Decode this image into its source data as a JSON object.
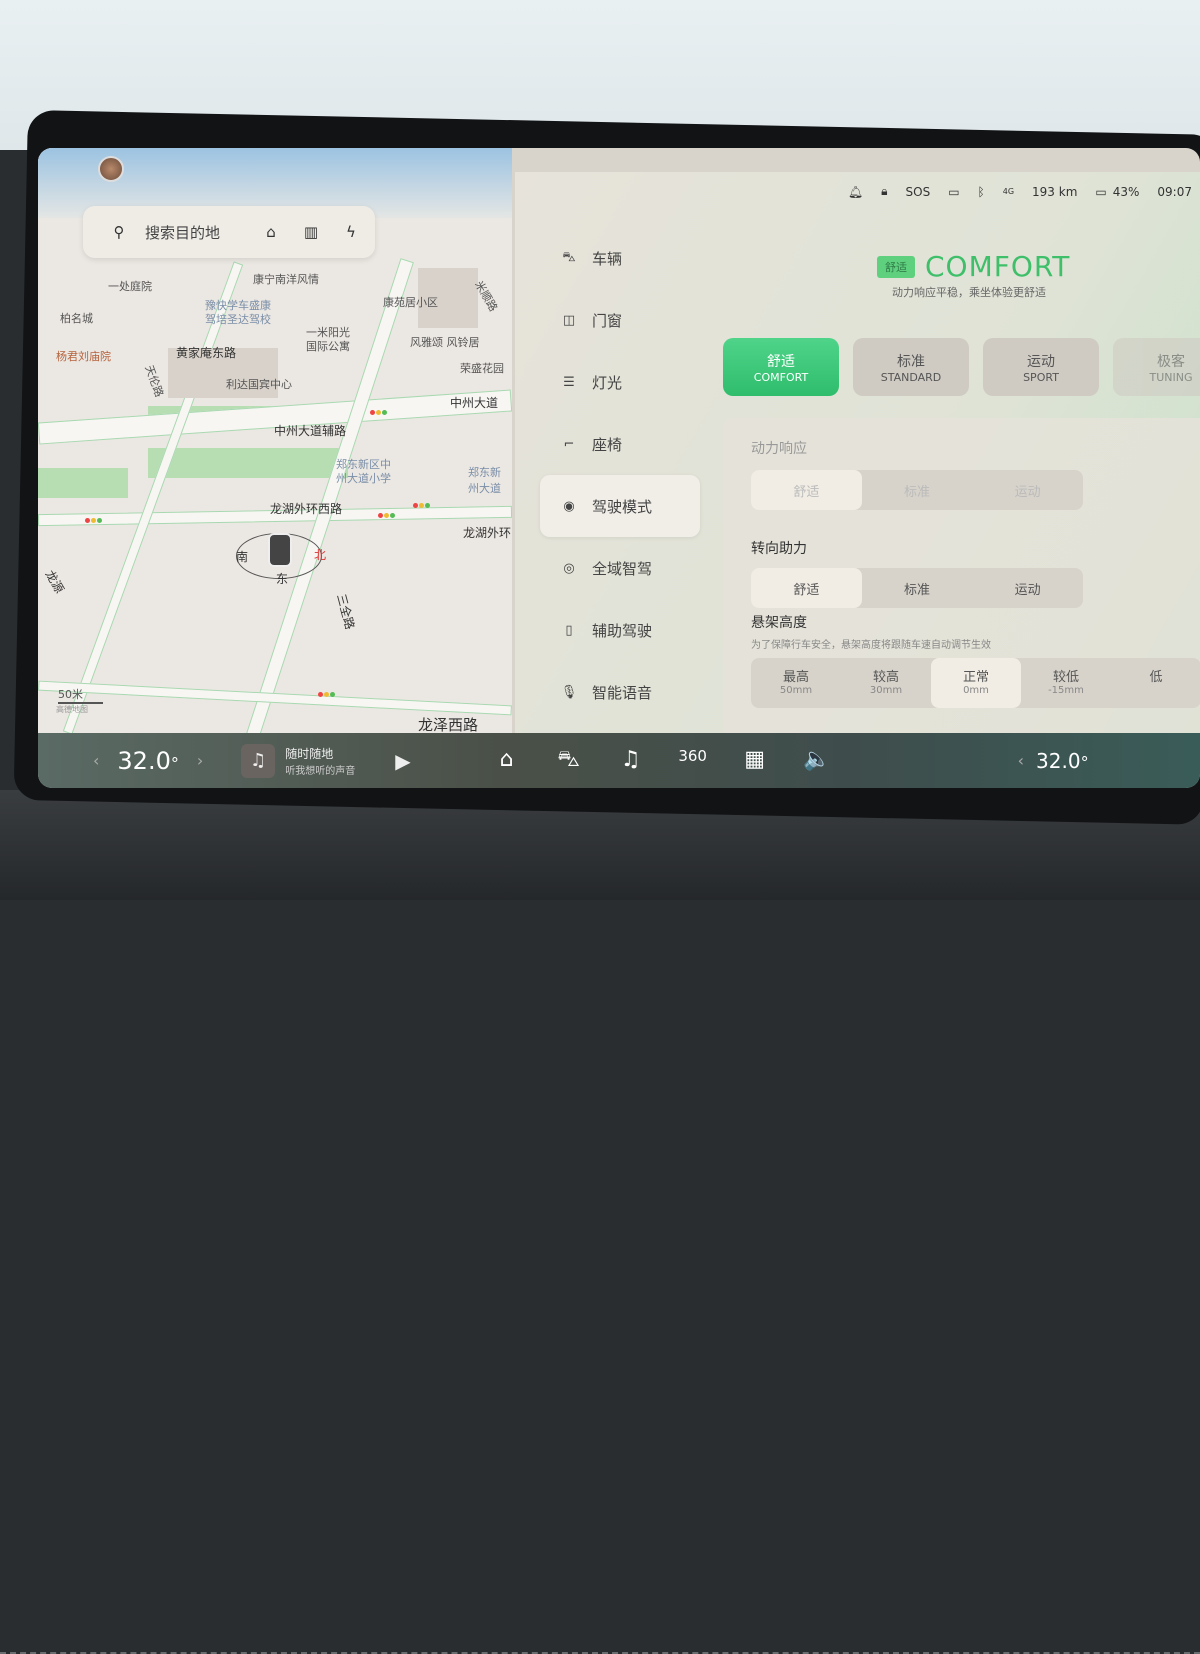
{
  "map": {
    "search_placeholder": "搜索目的地",
    "shortcuts": [
      {
        "icon": "home-icon",
        "glyph": "⌂"
      },
      {
        "icon": "company-icon",
        "glyph": "▥"
      },
      {
        "icon": "charging-icon",
        "glyph": "ϟ"
      }
    ],
    "labels": [
      "一处庭院",
      "康宁南洋风情",
      "豫快学车盛康",
      "驾培圣达驾校",
      "柏名城",
      "康苑居小区",
      "一米阳光",
      "国际公寓",
      "风雅颂 风铃居",
      "杨君刘庙院",
      "黄家庵东路",
      "荣盛花园",
      "利达国宾中心",
      "天伦路",
      "中州大道",
      "中州大道辅路",
      "郑东新区中",
      "州大道小学",
      "郑东新",
      "州大道",
      "龙湖外环西路",
      "龙湖外环",
      "龙源",
      "三全路",
      "龙泽西路",
      "米顺路"
    ],
    "compass": {
      "south": "南",
      "north": "北",
      "east": "东"
    },
    "scale": "50米",
    "attribution": "高德地图"
  },
  "status": {
    "items": [
      "bell-icon",
      "lock-icon"
    ],
    "sos": "SOS",
    "signal": "4G",
    "range": "193 km",
    "battery": "43%",
    "time": "09:07"
  },
  "nav": [
    {
      "label": "车辆",
      "icon": "car-icon",
      "glyph": "⛍"
    },
    {
      "label": "门窗",
      "icon": "door-icon",
      "glyph": "◫"
    },
    {
      "label": "灯光",
      "icon": "light-icon",
      "glyph": "☰"
    },
    {
      "label": "座椅",
      "icon": "seat-icon",
      "glyph": "⌐"
    },
    {
      "label": "驾驶模式",
      "icon": "steering-wheel-icon",
      "glyph": "◉",
      "active": true
    },
    {
      "label": "全域智驾",
      "icon": "smart-drive-icon",
      "glyph": "◎"
    },
    {
      "label": "辅助驾驶",
      "icon": "assist-drive-icon",
      "glyph": "▯"
    },
    {
      "label": "智能语音",
      "icon": "microphone-icon",
      "glyph": "🎙"
    }
  ],
  "hero": {
    "tag": "舒适",
    "title": "COMFORT",
    "subtitle": "动力响应平稳，乘坐体验更舒适"
  },
  "modes": [
    {
      "cn": "舒适",
      "en": "COMFORT",
      "active": true
    },
    {
      "cn": "标准",
      "en": "STANDARD"
    },
    {
      "cn": "运动",
      "en": "SPORT"
    },
    {
      "cn": "极客",
      "en": "TUNING"
    }
  ],
  "power_response": {
    "title": "动力响应",
    "options": [
      "舒适",
      "标准",
      "运动"
    ],
    "selected": 0
  },
  "steering": {
    "title": "转向助力",
    "options": [
      "舒适",
      "标准",
      "运动"
    ],
    "selected": 0
  },
  "suspension": {
    "title": "悬架高度",
    "note": "为了保障行车安全，悬架高度将跟随车速自动调节生效",
    "options": [
      {
        "label": "最高",
        "value": "50mm"
      },
      {
        "label": "较高",
        "value": "30mm"
      },
      {
        "label": "正常",
        "value": "0mm"
      },
      {
        "label": "较低",
        "value": "-15mm"
      },
      {
        "label": "低",
        "value": ""
      }
    ],
    "selected": 2
  },
  "dock": {
    "temp_left": "32.0",
    "temp_right": "32.0",
    "degree": "°",
    "music_title": "随时随地",
    "music_subtitle": "听我想听的声音",
    "icons": [
      {
        "name": "home-icon",
        "glyph": "⌂"
      },
      {
        "name": "car-icon",
        "glyph": "⛍"
      },
      {
        "name": "music-icon",
        "glyph": "♫"
      },
      {
        "name": "360-camera-icon",
        "glyph": "360"
      },
      {
        "name": "apps-icon",
        "glyph": "▦"
      },
      {
        "name": "volume-icon",
        "glyph": "🔈"
      }
    ]
  },
  "colors": {
    "accent": "#3fbf6a",
    "active_mode": "#2fbd6c"
  }
}
